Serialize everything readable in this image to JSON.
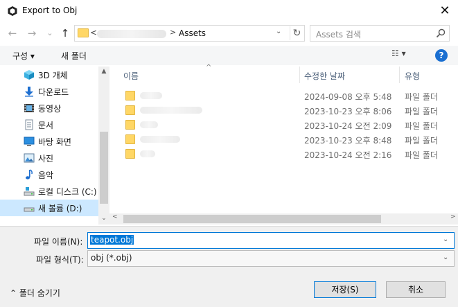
{
  "window": {
    "title": "Export to Obj",
    "close_glyph": "✕"
  },
  "address": {
    "back_glyph": "←",
    "forward_glyph": "→",
    "recent_glyph": "⌄",
    "up_glyph": "↑",
    "lt": "<",
    "gt": ">",
    "current": "Assets",
    "dropdown_glyph": "⌄",
    "refresh_glyph": "↻"
  },
  "search": {
    "placeholder": "Assets 검색"
  },
  "toolbar": {
    "organize_label": "구성 ▾",
    "new_folder_label": "새 폴더",
    "view_glyph": "☷ ▾",
    "help_glyph": "?"
  },
  "nav": {
    "items": [
      {
        "label": "3D 개체",
        "icon": "3d-objects-icon"
      },
      {
        "label": "다운로드",
        "icon": "download-icon"
      },
      {
        "label": "동영상",
        "icon": "video-icon"
      },
      {
        "label": "문서",
        "icon": "document-icon"
      },
      {
        "label": "바탕 화면",
        "icon": "desktop-icon"
      },
      {
        "label": "사진",
        "icon": "pictures-icon"
      },
      {
        "label": "음악",
        "icon": "music-icon"
      },
      {
        "label": "로컬 디스크 (C:)",
        "icon": "drive-c-icon"
      },
      {
        "label": "새 볼륨 (D:)",
        "icon": "drive-d-icon",
        "selected": true
      }
    ],
    "scroll_up_glyph": "▲",
    "scroll_down_glyph": "⌄"
  },
  "list": {
    "columns": {
      "name": "이름",
      "date": "수정한 날짜",
      "type": "유형"
    },
    "sort_glyph": "^",
    "rows": [
      {
        "date": "2024-09-08 오후 5:48",
        "type": "파일 폴더"
      },
      {
        "date": "2023-10-23 오후 8:06",
        "type": "파일 폴더"
      },
      {
        "date": "2023-10-24 오전 2:09",
        "type": "파일 폴더"
      },
      {
        "date": "2023-10-23 오후 8:48",
        "type": "파일 폴더"
      },
      {
        "date": "2023-10-24 오전 2:16",
        "type": "파일 폴더"
      }
    ],
    "h_left_glyph": "<",
    "h_right_glyph": ">"
  },
  "form": {
    "filename_label": "파일 이름(N):",
    "filename_value": "teapot.obj",
    "filetype_label": "파일 형식(T):",
    "filetype_value": "obj (*.obj)",
    "dropdown_glyph": "⌄"
  },
  "footer": {
    "hide_folders_label": "⌃ 폴더 숨기기",
    "save_label": "저장(S)",
    "cancel_label": "취소"
  },
  "colors": {
    "accent": "#0078d7",
    "selected_nav": "#cce8ff",
    "folder": "#ffd766",
    "help": "#1a6fd1"
  }
}
